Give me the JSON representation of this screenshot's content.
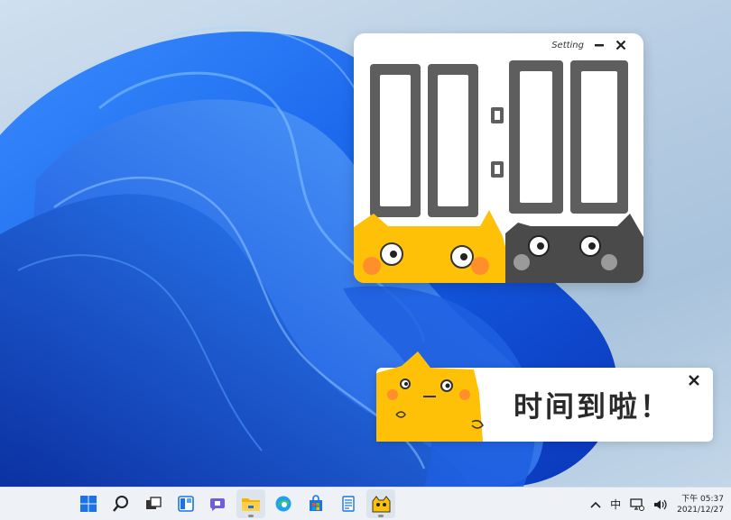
{
  "timer": {
    "setting_label": "Setting",
    "minutes": "00",
    "seconds": "00",
    "colors": {
      "yellow_cat": "#ffc107",
      "grey_cat": "#4a4a4a",
      "digit": "#5e5e5e"
    }
  },
  "notification": {
    "message": "时间到啦！"
  },
  "taskbar": {
    "icons": [
      "windows-start-icon",
      "search-icon",
      "task-view-icon",
      "widgets-icon",
      "chat-icon",
      "file-explorer-icon",
      "edge-icon",
      "store-icon",
      "notepad-icon",
      "cat-timer-icon"
    ],
    "tray": {
      "ime": "中",
      "time": "下午 05:37",
      "date": "2021/12/27"
    }
  }
}
